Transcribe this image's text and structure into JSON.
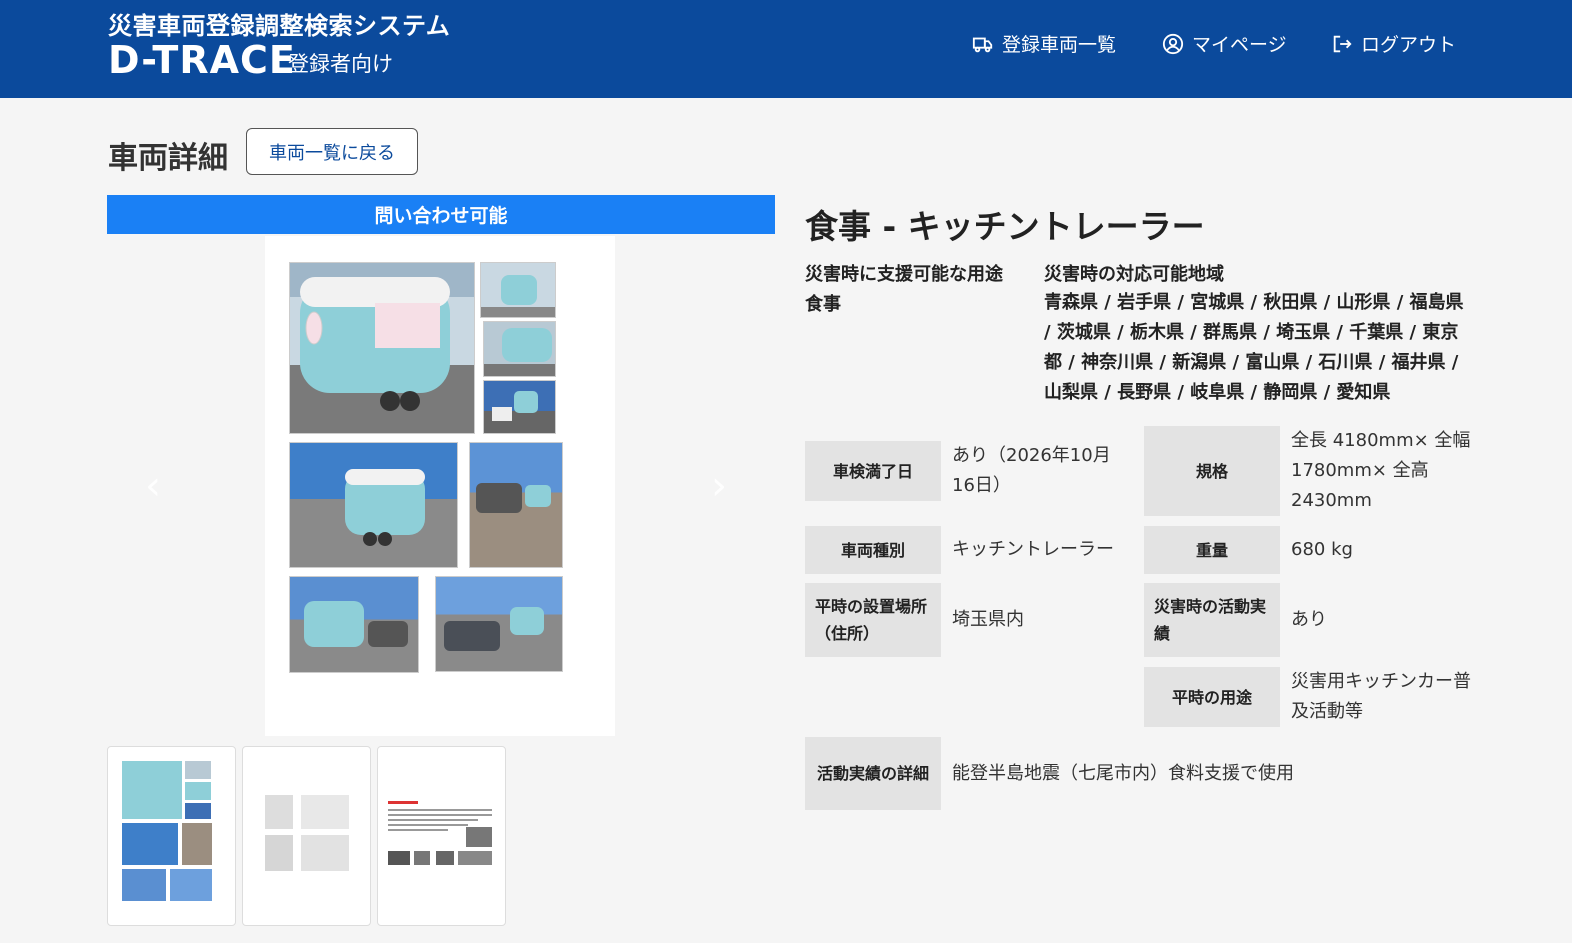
{
  "header": {
    "system_name": "災害車両登録調整検索システム",
    "brand": "D-TRACE",
    "audience": "登録者向け",
    "nav": {
      "vehicle_list": "登録車両一覧",
      "my_page": "マイページ",
      "logout": "ログアウト"
    }
  },
  "page": {
    "title": "車両詳細",
    "back_button": "車両一覧に戻る"
  },
  "status": "問い合わせ可能",
  "carousel": {
    "prev_icon": "‹",
    "next_icon": "›"
  },
  "vehicle": {
    "title": "食事 - キッチントレーラー",
    "uses_label": "災害時に支援可能な用途",
    "uses_value": "食事",
    "regions_label": "災害時の対応可能地域",
    "regions_value": "青森県 / 岩手県 / 宮城県 / 秋田県 / 山形県 / 福島県 / 茨城県 / 栃木県 / 群馬県 / 埼玉県 / 千葉県 / 東京都 / 神奈川県 / 新潟県 / 富山県 / 石川県 / 福井県 / 山梨県 / 長野県 / 岐阜県 / 静岡県 / 愛知県"
  },
  "details": {
    "inspection_label": "車検満了日",
    "inspection_value": "あり（2026年10月16日）",
    "spec_label": "規格",
    "spec_value": "全長 4180mm× 全幅 1780mm× 全高 2430mm",
    "type_label": "車両種別",
    "type_value": "キッチントレーラー",
    "weight_label": "重量",
    "weight_value": "680 kg",
    "location_label": "平時の設置場所（住所）",
    "location_value": "埼玉県内",
    "activity_label": "災害時の活動実績",
    "activity_value": "あり",
    "normal_use_label": "平時の用途",
    "normal_use_value": "災害用キッチンカー普及活動等",
    "activity_detail_label": "活動実績の詳細",
    "activity_detail_value": "能登半島地震（七尾市内）食料支援で使用"
  },
  "colors": {
    "header_bg": "#0b4a9c",
    "status_bg": "#1a80f5",
    "trailer": "#8ecfd8"
  }
}
